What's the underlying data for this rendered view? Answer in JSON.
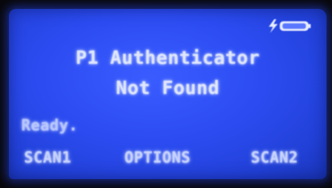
{
  "screen": {
    "title": "P1 Authenticator",
    "subtitle": "Not Found",
    "status": "Ready.",
    "softkeys": {
      "left": "SCAN1",
      "middle": "OPTIONS",
      "right": "SCAN2"
    },
    "indicators": {
      "power_icon": "lightning-bolt-icon",
      "battery_icon": "battery-icon"
    }
  },
  "colors": {
    "lcd_background": "#2c4cf2",
    "lcd_text": "#dfe6ff"
  }
}
